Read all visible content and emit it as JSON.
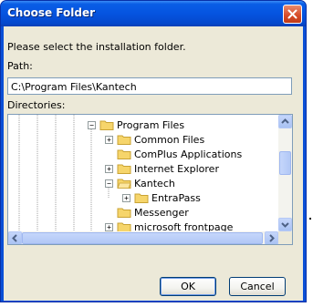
{
  "window": {
    "title": "Choose Folder"
  },
  "dialog": {
    "instruction": "Please select the installation folder.",
    "path_label": "Path:",
    "path_value": "C:\\Program Files\\Kantech",
    "directories_label": "Directories:"
  },
  "tree": {
    "items": [
      {
        "label": "Program Files",
        "expanded": true,
        "expander": "minus"
      },
      {
        "label": "Common Files",
        "expander": "plus"
      },
      {
        "label": "ComPlus Applications",
        "expander": "none"
      },
      {
        "label": "Internet Explorer",
        "expander": "plus"
      },
      {
        "label": "Kantech",
        "expander": "minus",
        "selected": true
      },
      {
        "label": "EntraPass",
        "expander": "plus"
      },
      {
        "label": "Messenger",
        "expander": "none"
      },
      {
        "label": "microsoft frontpage",
        "expander": "plus"
      }
    ]
  },
  "buttons": {
    "ok": "OK",
    "cancel": "Cancel"
  },
  "colors": {
    "titlebar": "#0554e0",
    "client_bg": "#ece9d8",
    "close_button": "#d64a26",
    "folder_yellow": "#f6d56b"
  },
  "icons": {
    "close": "close-icon",
    "folder": "folder-icon",
    "expand": "plus-icon",
    "collapse": "minus-icon"
  }
}
